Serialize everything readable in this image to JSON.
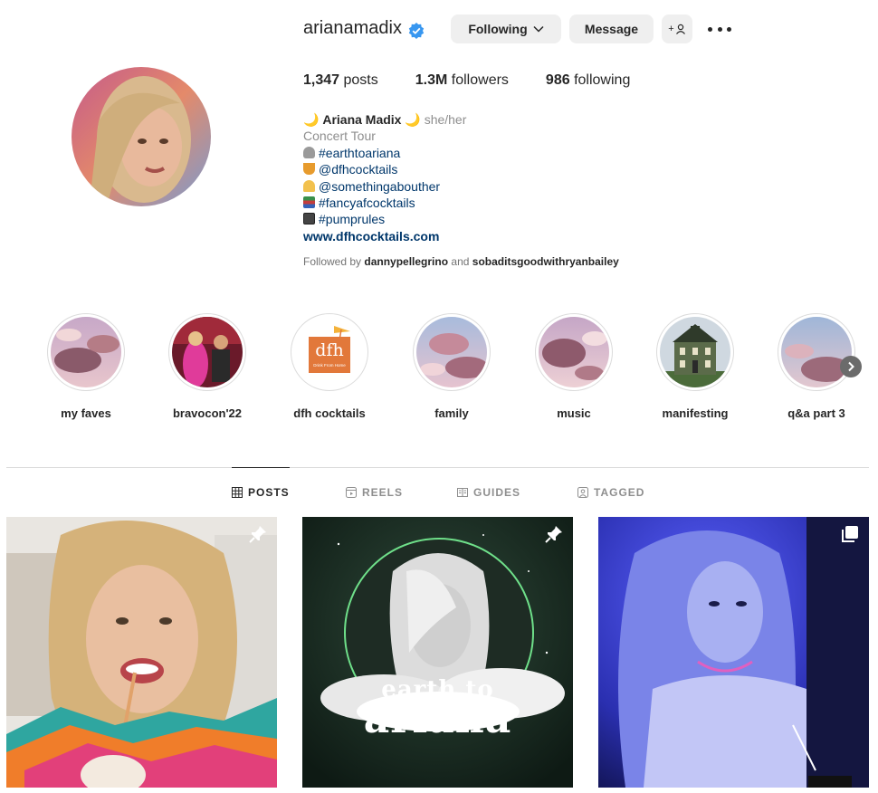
{
  "profile": {
    "username": "arianamadix",
    "verified": true,
    "buttons": {
      "following_label": "Following",
      "message_label": "Message",
      "add_user_label": "+"
    },
    "stats": [
      {
        "count": "1,347",
        "label": "posts"
      },
      {
        "count": "1.3M",
        "label": "followers"
      },
      {
        "count": "986",
        "label": "following"
      }
    ],
    "bio": {
      "name": "Ariana Madix",
      "pronouns": "she/her",
      "category": "Concert Tour",
      "lines": [
        {
          "icon": "headphones-emoji",
          "text": "#earthtoariana"
        },
        {
          "icon": "cocktail-emoji",
          "text": "@dfhcocktails"
        },
        {
          "icon": "taco-emoji",
          "text": "@somethingabouther"
        },
        {
          "icon": "books-emoji",
          "text": "#fancyafcocktails"
        },
        {
          "icon": "tv-emoji",
          "text": "#pumprules"
        }
      ],
      "website": "www.dfhcocktails.com"
    },
    "followed_by": {
      "prefix": "Followed by",
      "user1": "dannypellegrino",
      "conj": "and",
      "user2": "sobaditsgoodwithryanbailey"
    }
  },
  "highlights": [
    {
      "label": "my faves"
    },
    {
      "label": "bravocon'22"
    },
    {
      "label": "dfh cocktails",
      "logo_text": "dfh",
      "logo_sub": "Drink From Home"
    },
    {
      "label": "family"
    },
    {
      "label": "music"
    },
    {
      "label": "manifesting"
    },
    {
      "label": "q&a part 3"
    }
  ],
  "tabs": [
    {
      "label": "POSTS",
      "icon": "grid-icon",
      "active": true
    },
    {
      "label": "REELS",
      "icon": "reels-icon",
      "active": false
    },
    {
      "label": "GUIDES",
      "icon": "guides-icon",
      "active": false
    },
    {
      "label": "TAGGED",
      "icon": "tagged-icon",
      "active": false
    }
  ],
  "posts": [
    {
      "icon": "pin-icon",
      "overlay_text": ""
    },
    {
      "icon": "pin-icon",
      "overlay_line1": "earth to",
      "overlay_line2": "ariana"
    },
    {
      "icon": "carousel-icon",
      "overlay_text": ""
    }
  ],
  "colors": {
    "accent_link": "#00376b",
    "verified_blue": "#3897f0",
    "button_bg": "#efefef",
    "divider": "#dbdbdb"
  }
}
